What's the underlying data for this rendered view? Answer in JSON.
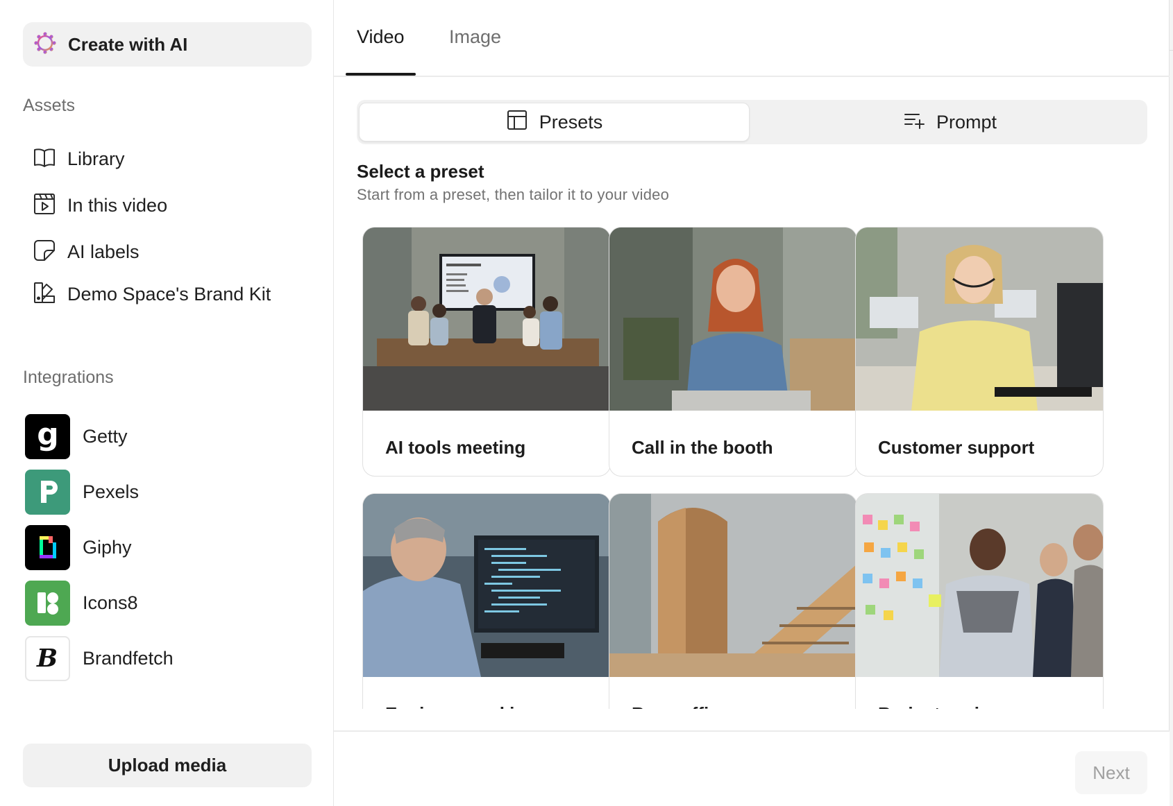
{
  "sidebar": {
    "create_ai_label": "Create with AI",
    "assets_heading": "Assets",
    "assets": [
      {
        "label": "Library",
        "icon": "book-icon"
      },
      {
        "label": "In this video",
        "icon": "video-clip-icon"
      },
      {
        "label": "AI labels",
        "icon": "sticker-icon"
      },
      {
        "label": "Demo Space's Brand Kit",
        "icon": "brand-kit-icon"
      }
    ],
    "integrations_heading": "Integrations",
    "integrations": [
      {
        "label": "Getty",
        "icon": "getty-logo",
        "color": "#000000"
      },
      {
        "label": "Pexels",
        "icon": "pexels-logo",
        "color": "#3d9a7a"
      },
      {
        "label": "Giphy",
        "icon": "giphy-logo",
        "color": "#000000"
      },
      {
        "label": "Icons8",
        "icon": "icons8-logo",
        "color": "#4ea852"
      },
      {
        "label": "Brandfetch",
        "icon": "brandfetch-logo",
        "color": "#ffffff"
      }
    ],
    "upload_label": "Upload media"
  },
  "main": {
    "tabs": [
      {
        "label": "Video",
        "active": true
      },
      {
        "label": "Image",
        "active": false
      }
    ],
    "segments": [
      {
        "label": "Presets",
        "icon": "layout-icon",
        "selected": true
      },
      {
        "label": "Prompt",
        "icon": "prompt-add-icon",
        "selected": false
      }
    ],
    "select_title": "Select a preset",
    "select_subtitle": "Start from a preset, then tailor it to your video",
    "presets": [
      {
        "title": "AI tools meeting"
      },
      {
        "title": "Call in the booth"
      },
      {
        "title": "Customer support"
      },
      {
        "title": "Engineer working"
      },
      {
        "title": "Busy office"
      },
      {
        "title": "Brainstorming"
      }
    ],
    "next_label": "Next"
  },
  "colors": {
    "accent_gradient": [
      "#f05a7e",
      "#a05ae0",
      "#f0a040"
    ],
    "panel_bg": "#ffffff",
    "chip_bg": "#f1f1f1"
  }
}
